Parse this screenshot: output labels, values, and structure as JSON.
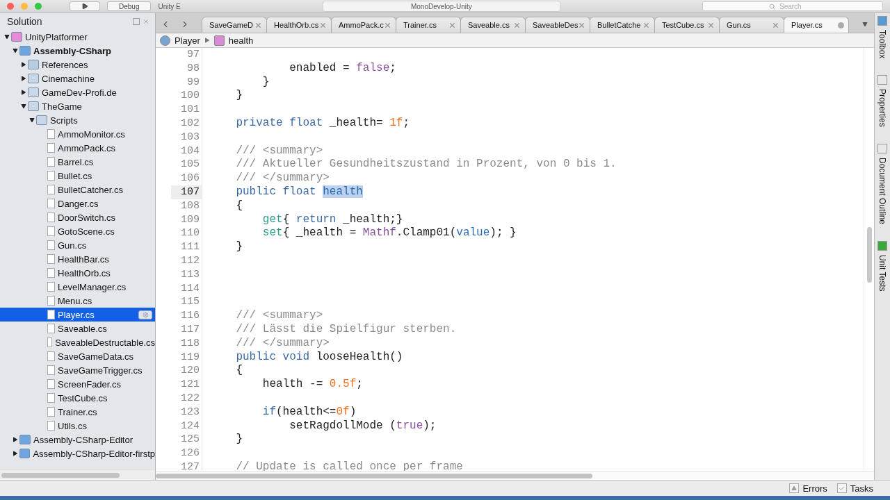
{
  "toolbar": {
    "configuration": "Debug",
    "target": "Unity E",
    "title": "MonoDevelop-Unity",
    "search": {
      "placeholder": "Search"
    }
  },
  "solution_pad": {
    "title": "Solution",
    "tree": [
      {
        "label": "UnityPlatformer",
        "kind": "solution",
        "expanded": true,
        "selected": false,
        "children": [
          {
            "label": "Assembly-CSharp",
            "kind": "project",
            "expanded": true,
            "selected": false,
            "children": [
              {
                "label": "References",
                "kind": "references",
                "expanded": false,
                "selected": false
              },
              {
                "label": "Cinemachine",
                "kind": "folder",
                "expanded": false,
                "selected": false
              },
              {
                "label": "GameDev-Profi.de",
                "kind": "folder",
                "expanded": false,
                "selected": false
              },
              {
                "label": "TheGame",
                "kind": "folder",
                "expanded": true,
                "selected": false,
                "children": [
                  {
                    "label": "Scripts",
                    "kind": "folder",
                    "expanded": true,
                    "selected": false,
                    "children": [
                      {
                        "label": "AmmoMonitor.cs",
                        "kind": "file",
                        "selected": false
                      },
                      {
                        "label": "AmmoPack.cs",
                        "kind": "file",
                        "selected": false
                      },
                      {
                        "label": "Barrel.cs",
                        "kind": "file",
                        "selected": false
                      },
                      {
                        "label": "Bullet.cs",
                        "kind": "file",
                        "selected": false
                      },
                      {
                        "label": "BulletCatcher.cs",
                        "kind": "file",
                        "selected": false
                      },
                      {
                        "label": "Danger.cs",
                        "kind": "file",
                        "selected": false
                      },
                      {
                        "label": "DoorSwitch.cs",
                        "kind": "file",
                        "selected": false
                      },
                      {
                        "label": "GotoScene.cs",
                        "kind": "file",
                        "selected": false
                      },
                      {
                        "label": "Gun.cs",
                        "kind": "file",
                        "selected": false
                      },
                      {
                        "label": "HealthBar.cs",
                        "kind": "file",
                        "selected": false
                      },
                      {
                        "label": "HealthOrb.cs",
                        "kind": "file",
                        "selected": false
                      },
                      {
                        "label": "LevelManager.cs",
                        "kind": "file",
                        "selected": false
                      },
                      {
                        "label": "Menu.cs",
                        "kind": "file",
                        "selected": false
                      },
                      {
                        "label": "Player.cs",
                        "kind": "file",
                        "selected": true
                      },
                      {
                        "label": "Saveable.cs",
                        "kind": "file",
                        "selected": false
                      },
                      {
                        "label": "SaveableDestructable.cs",
                        "kind": "file",
                        "selected": false
                      },
                      {
                        "label": "SaveGameData.cs",
                        "kind": "file",
                        "selected": false
                      },
                      {
                        "label": "SaveGameTrigger.cs",
                        "kind": "file",
                        "selected": false
                      },
                      {
                        "label": "ScreenFader.cs",
                        "kind": "file",
                        "selected": false
                      },
                      {
                        "label": "TestCube.cs",
                        "kind": "file",
                        "selected": false
                      },
                      {
                        "label": "Trainer.cs",
                        "kind": "file",
                        "selected": false
                      },
                      {
                        "label": "Utils.cs",
                        "kind": "file",
                        "selected": false
                      }
                    ]
                  }
                ]
              }
            ]
          },
          {
            "label": "Assembly-CSharp-Editor",
            "kind": "project",
            "expanded": false,
            "selected": false
          },
          {
            "label": "Assembly-CSharp-Editor-firstp",
            "kind": "project",
            "expanded": false,
            "selected": false
          }
        ]
      }
    ]
  },
  "tabs": [
    {
      "label": "SaveGameD",
      "selected": false,
      "modified": false
    },
    {
      "label": "HealthOrb.cs",
      "selected": false,
      "modified": false
    },
    {
      "label": "AmmoPack.c",
      "selected": false,
      "modified": false
    },
    {
      "label": "Trainer.cs",
      "selected": false,
      "modified": false
    },
    {
      "label": "Saveable.cs",
      "selected": false,
      "modified": false
    },
    {
      "label": "SaveableDes",
      "selected": false,
      "modified": false
    },
    {
      "label": "BulletCatche",
      "selected": false,
      "modified": false
    },
    {
      "label": "TestCube.cs",
      "selected": false,
      "modified": false
    },
    {
      "label": "Gun.cs",
      "selected": false,
      "modified": false
    },
    {
      "label": "Player.cs",
      "selected": true,
      "modified": true
    }
  ],
  "breadcrumb": [
    {
      "label": "Player",
      "kind": "class"
    },
    {
      "label": "health",
      "kind": "property"
    }
  ],
  "code_lines": [
    {
      "number": "97",
      "current": false
    },
    {
      "number": "98",
      "current": false,
      "tokens": [
        {
          "kind": "plain",
          "text": "            enabled = "
        },
        {
          "kind": "literal",
          "text": "false"
        },
        {
          "kind": "plain",
          "text": ";"
        }
      ]
    },
    {
      "number": "99",
      "current": false,
      "tokens": [
        {
          "kind": "plain",
          "text": "        }"
        }
      ]
    },
    {
      "number": "100",
      "current": false,
      "tokens": [
        {
          "kind": "plain",
          "text": "    }"
        }
      ]
    },
    {
      "number": "101",
      "current": false
    },
    {
      "number": "102",
      "current": false,
      "tokens": [
        {
          "kind": "keyword",
          "text": "    private float"
        },
        {
          "kind": "plain",
          "text": " _health= "
        },
        {
          "kind": "number",
          "text": "1f"
        },
        {
          "kind": "plain",
          "text": ";"
        }
      ]
    },
    {
      "number": "103",
      "current": false
    },
    {
      "number": "104",
      "current": false,
      "tokens": [
        {
          "kind": "comment",
          "text": "    /// <summary>"
        }
      ]
    },
    {
      "number": "105",
      "current": false,
      "tokens": [
        {
          "kind": "comment",
          "text": "    /// Aktueller Gesundheitszustand in Prozent, von 0 bis 1."
        }
      ]
    },
    {
      "number": "106",
      "current": false,
      "tokens": [
        {
          "kind": "comment",
          "text": "    /// </summary>"
        }
      ]
    },
    {
      "number": "107",
      "current": true,
      "tokens": [
        {
          "kind": "keyword",
          "text": "    public float "
        },
        {
          "kind": "selection",
          "text": "health"
        }
      ]
    },
    {
      "number": "108",
      "current": false,
      "tokens": [
        {
          "kind": "plain",
          "text": "    {"
        }
      ]
    },
    {
      "number": "109",
      "current": false,
      "tokens": [
        {
          "kind": "accessor",
          "text": "        get"
        },
        {
          "kind": "plain",
          "text": "{ "
        },
        {
          "kind": "keyword",
          "text": "return"
        },
        {
          "kind": "plain",
          "text": " _health;}"
        }
      ]
    },
    {
      "number": "110",
      "current": false,
      "tokens": [
        {
          "kind": "accessor",
          "text": "        set"
        },
        {
          "kind": "plain",
          "text": "{ _health = "
        },
        {
          "kind": "type",
          "text": "Mathf"
        },
        {
          "kind": "plain",
          "text": ".Clamp01("
        },
        {
          "kind": "contextual",
          "text": "value"
        },
        {
          "kind": "plain",
          "text": "); }"
        }
      ]
    },
    {
      "number": "111",
      "current": false,
      "tokens": [
        {
          "kind": "plain",
          "text": "    }"
        }
      ]
    },
    {
      "number": "112",
      "current": false
    },
    {
      "number": "113",
      "current": false
    },
    {
      "number": "114",
      "current": false
    },
    {
      "number": "115",
      "current": false
    },
    {
      "number": "116",
      "current": false,
      "tokens": [
        {
          "kind": "comment",
          "text": "    /// <summary>"
        }
      ]
    },
    {
      "number": "117",
      "current": false,
      "tokens": [
        {
          "kind": "comment",
          "text": "    /// Lässt die Spielfigur sterben."
        }
      ]
    },
    {
      "number": "118",
      "current": false,
      "tokens": [
        {
          "kind": "comment",
          "text": "    /// </summary>"
        }
      ]
    },
    {
      "number": "119",
      "current": false,
      "tokens": [
        {
          "kind": "keyword",
          "text": "    public void"
        },
        {
          "kind": "plain",
          "text": " looseHealth()"
        }
      ]
    },
    {
      "number": "120",
      "current": false,
      "tokens": [
        {
          "kind": "plain",
          "text": "    {"
        }
      ]
    },
    {
      "number": "121",
      "current": false,
      "tokens": [
        {
          "kind": "plain",
          "text": "        health -= "
        },
        {
          "kind": "number",
          "text": "0.5f"
        },
        {
          "kind": "plain",
          "text": ";"
        }
      ]
    },
    {
      "number": "122",
      "current": false
    },
    {
      "number": "123",
      "current": false,
      "tokens": [
        {
          "kind": "keyword",
          "text": "        if"
        },
        {
          "kind": "plain",
          "text": "(health<="
        },
        {
          "kind": "number",
          "text": "0f"
        },
        {
          "kind": "plain",
          "text": ")"
        }
      ]
    },
    {
      "number": "124",
      "current": false,
      "tokens": [
        {
          "kind": "plain",
          "text": "            setRagdollMode ("
        },
        {
          "kind": "literal",
          "text": "true"
        },
        {
          "kind": "plain",
          "text": ");"
        }
      ]
    },
    {
      "number": "125",
      "current": false,
      "tokens": [
        {
          "kind": "plain",
          "text": "    }"
        }
      ]
    },
    {
      "number": "126",
      "current": false
    },
    {
      "number": "127",
      "current": false,
      "tokens": [
        {
          "kind": "comment",
          "text": "    // Update is called once per frame"
        }
      ]
    }
  ],
  "side_pads": [
    {
      "label": "Toolbox",
      "kind": "toolbox"
    },
    {
      "label": "Properties",
      "kind": "properties"
    },
    {
      "label": "Document Outline",
      "kind": "outline"
    },
    {
      "label": "Unit Tests",
      "kind": "tests"
    }
  ],
  "status_bar": [
    {
      "label": "Errors",
      "kind": "errors"
    },
    {
      "label": "Tasks",
      "kind": "tasks"
    }
  ]
}
